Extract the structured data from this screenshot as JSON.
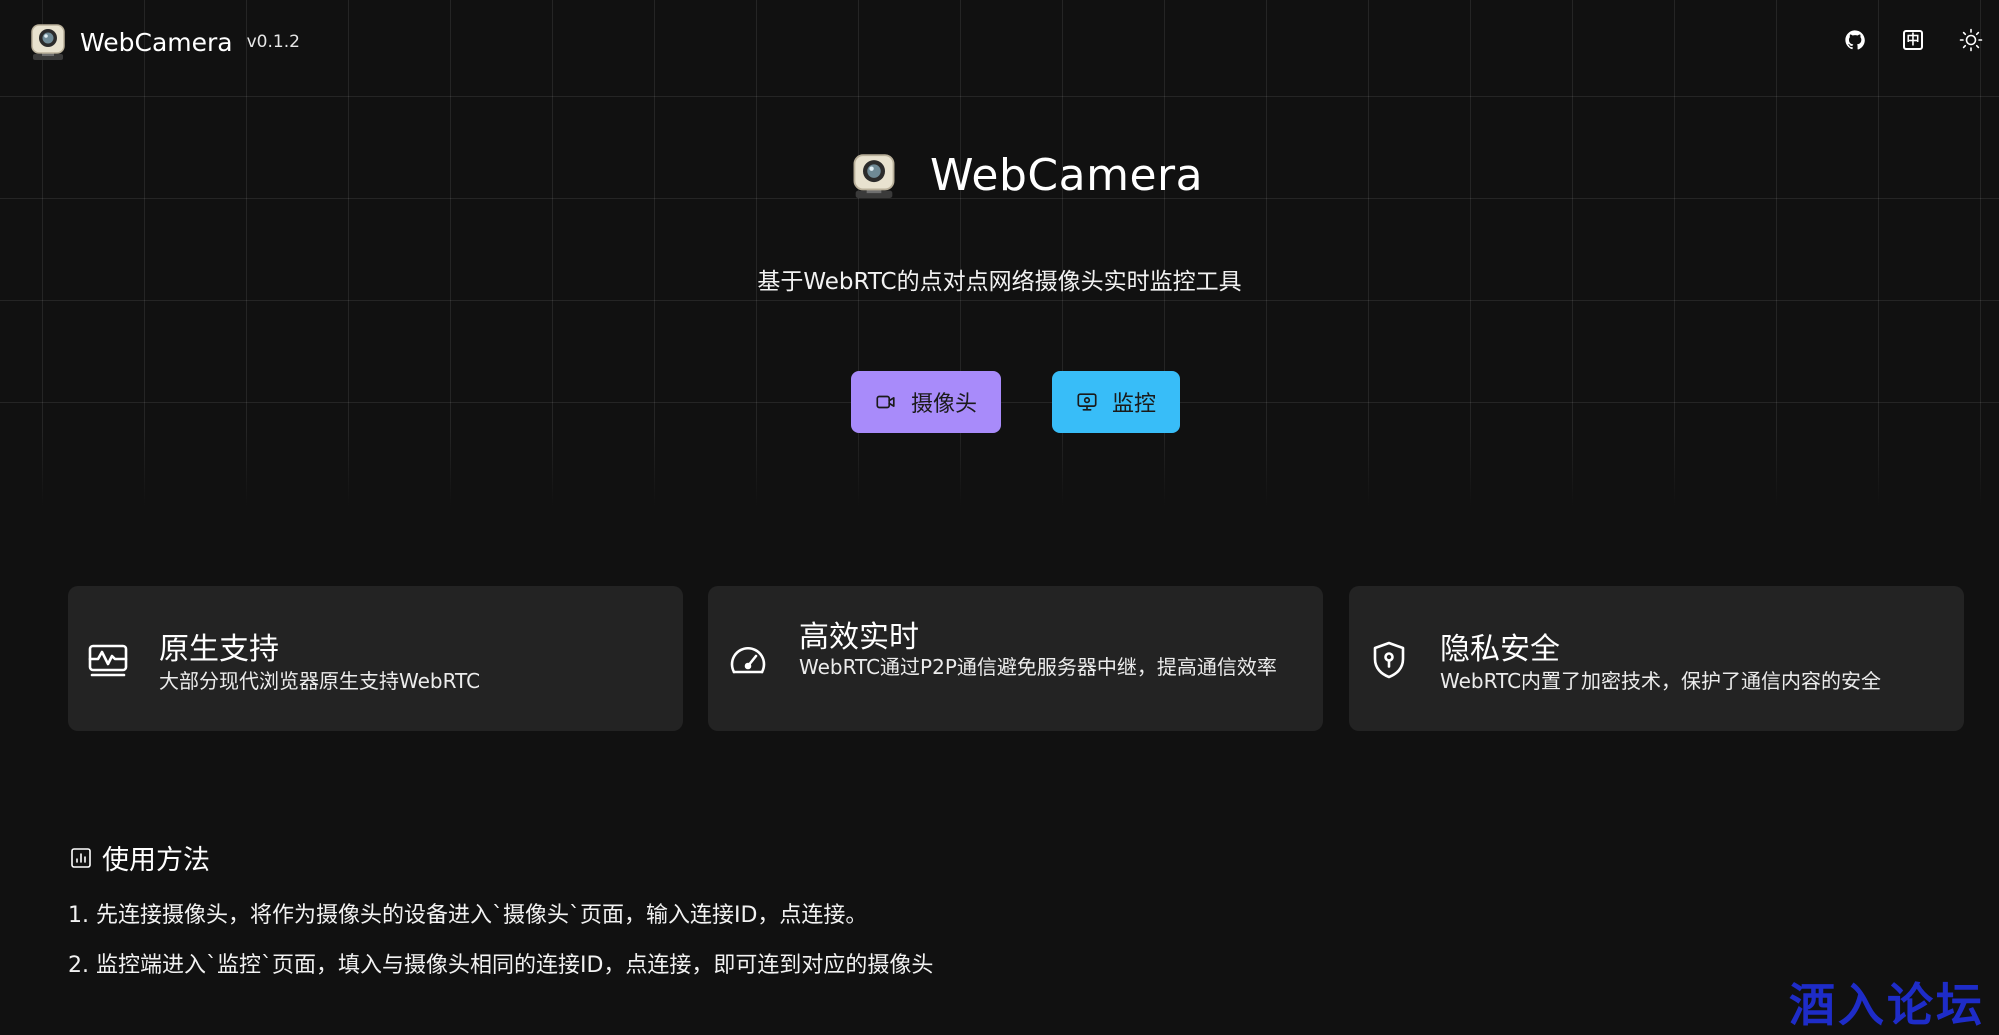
{
  "header": {
    "app_name": "WebCamera",
    "version": "v0.1.2",
    "actions": [
      {
        "icon": "github-icon"
      },
      {
        "icon": "language-icon",
        "label": "中"
      },
      {
        "icon": "sun-icon"
      }
    ]
  },
  "hero": {
    "title": "WebCamera",
    "subtitle": "基于WebRTC的点对点网络摄像头实时监控工具",
    "buttons": {
      "camera": {
        "label": "摄像头",
        "icon": "camera-icon",
        "color": "#a88bfa"
      },
      "monitor": {
        "label": "监控",
        "icon": "monitor-icon",
        "color": "#38bdf8"
      }
    }
  },
  "features": [
    {
      "icon": "chart-monitor-icon",
      "title": "原生支持",
      "desc": "大部分现代浏览器原生支持WebRTC"
    },
    {
      "icon": "speedometer-icon",
      "title": "高效实时",
      "desc": "WebRTC通过P2P通信避免服务器中继，提高通信效率"
    },
    {
      "icon": "shield-lock-icon",
      "title": "隐私安全",
      "desc": "WebRTC内置了加密技术，保护了通信内容的安全"
    }
  ],
  "usage": {
    "icon": "chart-icon",
    "title": "使用方法",
    "steps": [
      "1. 先连接摄像头，将作为摄像头的设备进入`摄像头`页面，输入连接ID，点连接。",
      "2. 监控端进入`监控`页面，填入与摄像头相同的连接ID，点连接，即可连到对应的摄像头"
    ]
  },
  "watermark": "酒入论坛",
  "colors": {
    "background": "#111111",
    "card": "#232323",
    "camera_button": "#a88bfa",
    "monitor_button": "#38bdf8",
    "watermark": "#1e2cc8"
  }
}
